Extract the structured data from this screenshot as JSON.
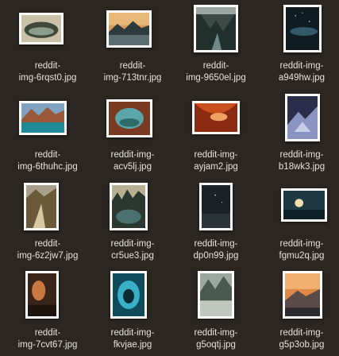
{
  "files": [
    {
      "line1": "reddit-",
      "line2": "img-6rqst0.jpg"
    },
    {
      "line1": "reddit-",
      "line2": "img-713tnr.jpg"
    },
    {
      "line1": "reddit-",
      "line2": "img-9650el.jpg"
    },
    {
      "line1": "reddit-img-",
      "line2": "a949hw.jpg"
    },
    {
      "line1": "reddit-",
      "line2": "img-6thuhc.jpg"
    },
    {
      "line1": "reddit-img-",
      "line2": "acv5lj.jpg"
    },
    {
      "line1": "reddit-img-",
      "line2": "ayjam2.jpg"
    },
    {
      "line1": "reddit-img-",
      "line2": "b18wk3.jpg"
    },
    {
      "line1": "reddit-",
      "line2": "img-6z2jw7.jpg"
    },
    {
      "line1": "reddit-img-",
      "line2": "cr5ue3.jpg"
    },
    {
      "line1": "reddit-img-",
      "line2": "dp0n99.jpg"
    },
    {
      "line1": "reddit-img-",
      "line2": "fgmu2q.jpg"
    },
    {
      "line1": "reddit-",
      "line2": "img-7cvt67.jpg"
    },
    {
      "line1": "reddit-img-",
      "line2": "fkvjae.jpg"
    },
    {
      "line1": "reddit-img-",
      "line2": "g5oqtj.jpg"
    },
    {
      "line1": "reddit-img-",
      "line2": "g5p3ob.jpg"
    }
  ]
}
